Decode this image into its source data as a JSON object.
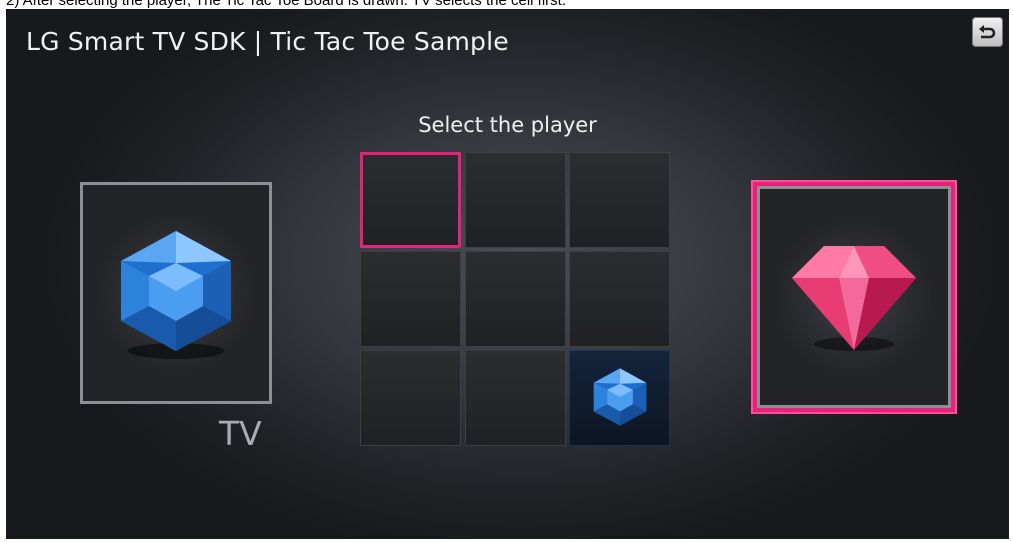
{
  "caption": "2) After selecting the player, The Tic Tac Toe Board is drawn. TV selects the cell first.",
  "app_title": "LG Smart TV SDK | Tic Tac Toe Sample",
  "prompt": "Select the player",
  "tv_player": {
    "label": "TV",
    "icon": "blue-hexagon-gem-icon"
  },
  "user_player": {
    "icon": "pink-diamond-gem-icon",
    "selected": true
  },
  "board": {
    "cells": [
      "",
      "",
      "",
      "",
      "",
      "",
      "",
      "",
      "TV"
    ],
    "focused_cell": 0
  },
  "back_button_icon": "back-arrow-icon",
  "colors": {
    "focus": "#e3237a",
    "tv_gem": "#3b8fe0",
    "user_gem": "#e83c7a"
  }
}
